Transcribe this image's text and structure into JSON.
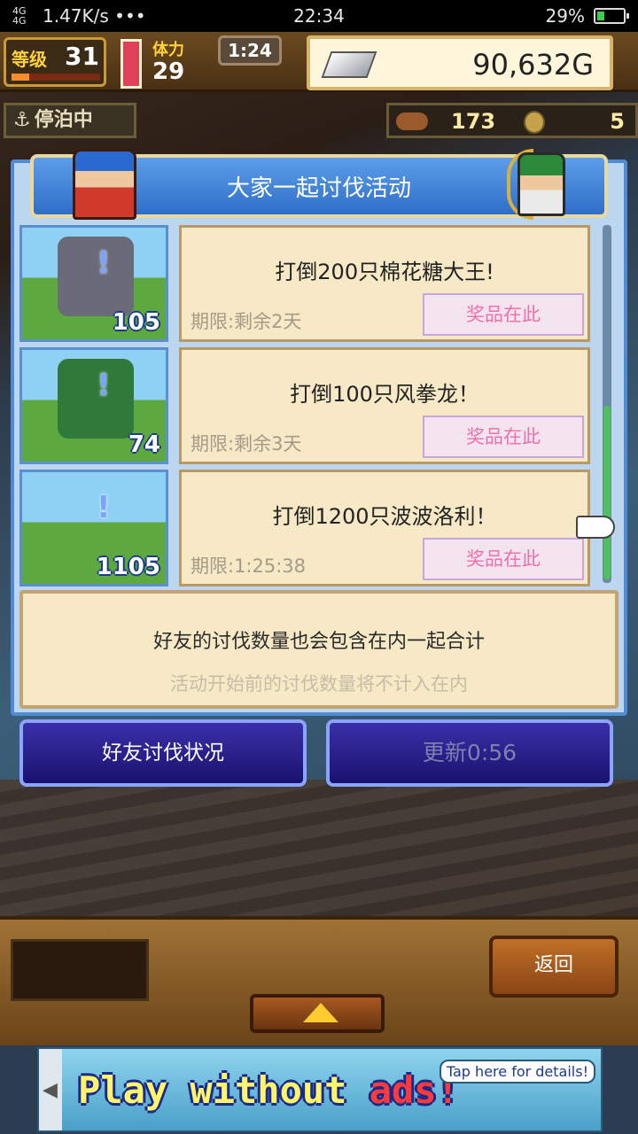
{
  "status_bar": {
    "signal": "4G 4G",
    "network_speed": "1.47K/s •••",
    "time": "22:34",
    "battery": "29%",
    "battery_level": 0.29,
    "battery_color": "#39d14b"
  },
  "hud": {
    "level_label": "等级",
    "level_value": "31",
    "level_progress": 0.2,
    "stamina_label": "体力",
    "stamina_value": "29",
    "timer": "1:24",
    "gold": "90,632G",
    "docked": "停泊中",
    "resource_a": "173",
    "resource_b": "5",
    "icons": [
      "anchor-icon",
      "ingot-icon",
      "meat-icon",
      "coin-icon"
    ]
  },
  "dialog": {
    "title": "大家一起讨伐活动",
    "quests": [
      {
        "title": "打倒200只棉花糖大王!",
        "deadline": "期限:剩余2天",
        "reward": "奖品在此",
        "level": "105",
        "mark": "!",
        "monster_color": "#6a6a78"
      },
      {
        "title": "打倒100只风拳龙！",
        "deadline": "期限:剩余3天",
        "reward": "奖品在此",
        "level": "74",
        "mark": "!",
        "monster_color": "#2f7a3a"
      },
      {
        "title": "打倒1200只波波洛利！",
        "deadline": "期限:1:25:38",
        "reward": "奖品在此",
        "level": "1105",
        "mark": "!",
        "monster_color": ""
      }
    ],
    "info_line1": "好友的讨伐数量也会包含在内一起合计",
    "info_line2": "活动开始前的讨伐数量将不计入在内",
    "friends_button": "好友讨伐状况",
    "update_button": "更新0:56"
  },
  "bottom": {
    "return_button": "返回",
    "up_icon": "up-arrow-icon"
  },
  "ad": {
    "text_main": "Play without ",
    "text_ads": "ads!",
    "tap": "Tap here for details!"
  }
}
